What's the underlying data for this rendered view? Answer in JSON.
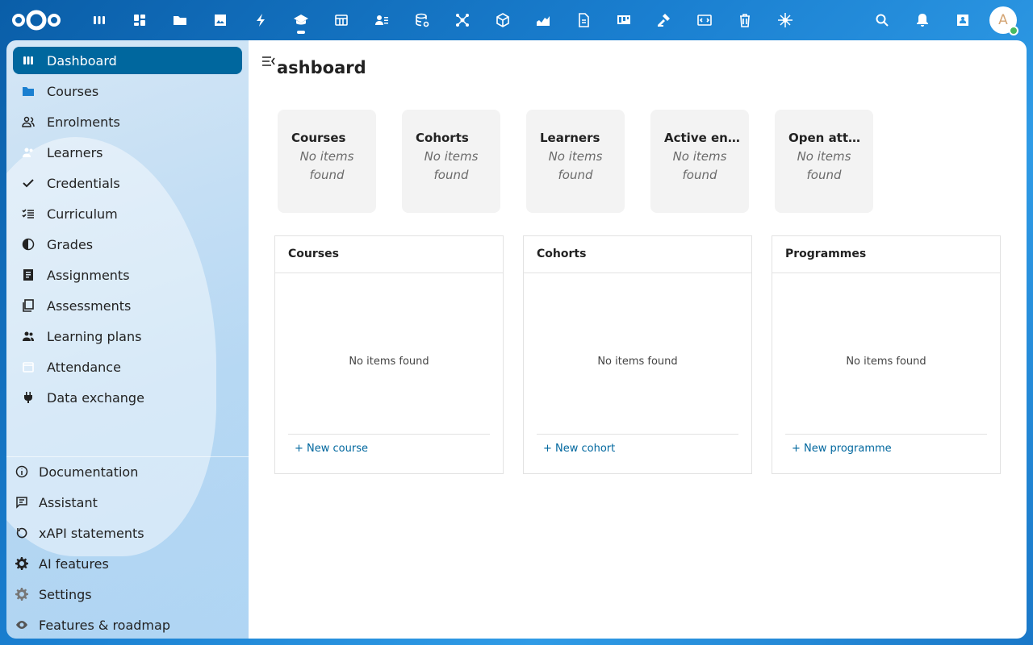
{
  "header": {
    "apps": [
      "dashboard-icon",
      "apps-grid-icon",
      "files-icon",
      "photos-icon",
      "activity-icon",
      "learning-icon",
      "table-icon",
      "contacts-icon",
      "database-icon",
      "flow-icon",
      "package-icon",
      "analytics-icon",
      "document-icon",
      "deck-icon",
      "hammer-icon",
      "code-icon",
      "trash-icon",
      "ornament-icon"
    ],
    "active_app_index": 5,
    "avatar_initial": "A"
  },
  "sidebar": {
    "items": [
      {
        "label": "Dashboard",
        "icon": "dashboard-icon",
        "active": true
      },
      {
        "label": "Courses",
        "icon": "folder-icon"
      },
      {
        "label": "Enrolments",
        "icon": "people-icon"
      },
      {
        "label": "Learners",
        "icon": "learners-icon"
      },
      {
        "label": "Credentials",
        "icon": "check-icon"
      },
      {
        "label": "Curriculum",
        "icon": "checklist-icon"
      },
      {
        "label": "Grades",
        "icon": "grades-icon"
      },
      {
        "label": "Assignments",
        "icon": "assignments-icon"
      },
      {
        "label": "Assessments",
        "icon": "assessments-icon"
      },
      {
        "label": "Learning plans",
        "icon": "plans-icon"
      },
      {
        "label": "Attendance",
        "icon": "calendar-icon"
      },
      {
        "label": "Data exchange",
        "icon": "plug-icon"
      }
    ],
    "bottom_items": [
      {
        "label": "Documentation",
        "icon": "info-icon"
      },
      {
        "label": "Assistant",
        "icon": "chat-icon"
      },
      {
        "label": "xAPI statements",
        "icon": "refresh-icon"
      },
      {
        "label": "AI features",
        "icon": "gear-icon"
      },
      {
        "label": "Settings",
        "icon": "settings-icon"
      },
      {
        "label": "Features & roadmap",
        "icon": "eye-icon"
      }
    ]
  },
  "main": {
    "title": "ashboard",
    "stats": [
      {
        "label": "Courses",
        "value": "No items found"
      },
      {
        "label": "Cohorts",
        "value": "No items found"
      },
      {
        "label": "Learners",
        "value": "No items found"
      },
      {
        "label": "Active en…",
        "value": "No items found"
      },
      {
        "label": "Open att…",
        "value": "No items found"
      }
    ],
    "panels": [
      {
        "title": "Courses",
        "empty": "No items found",
        "action": "+ New course"
      },
      {
        "title": "Cohorts",
        "empty": "No items found",
        "action": "+ New cohort"
      },
      {
        "title": "Programmes",
        "empty": "No items found",
        "action": "+ New programme"
      }
    ]
  },
  "colors": {
    "accent": "#00679e",
    "header_bg": "#0a5ea8"
  }
}
